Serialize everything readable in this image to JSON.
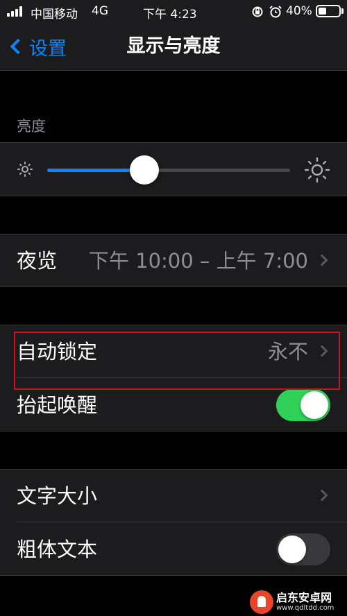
{
  "status_bar": {
    "carrier": "中国移动",
    "network": "4G",
    "time": "下午 4:23",
    "battery_percent": "40%",
    "battery_level": 0.4
  },
  "nav": {
    "back_label": "设置",
    "title": "显示与亮度"
  },
  "brightness": {
    "header": "亮度",
    "level": 0.4
  },
  "night_shift": {
    "label": "夜览",
    "value": "下午 10:00 – 上午 7:00"
  },
  "auto_lock": {
    "label": "自动锁定",
    "value": "永不"
  },
  "raise_to_wake": {
    "label": "抬起唤醒",
    "state": "on"
  },
  "text_size": {
    "label": "文字大小"
  },
  "bold_text": {
    "label": "粗体文本",
    "state": "off"
  },
  "colors": {
    "accent": "#0a84ff",
    "toggle_on": "#30d158",
    "annotation": "#d0141b"
  },
  "icons": [
    "signal-icon",
    "orientation-lock-icon",
    "alarm-icon",
    "battery-icon",
    "back-chevron-icon",
    "sun-small-icon",
    "sun-large-icon",
    "chevron-right-icon"
  ],
  "watermark": {
    "main": "启东安卓网",
    "sub": "www.qdltdd.com"
  }
}
